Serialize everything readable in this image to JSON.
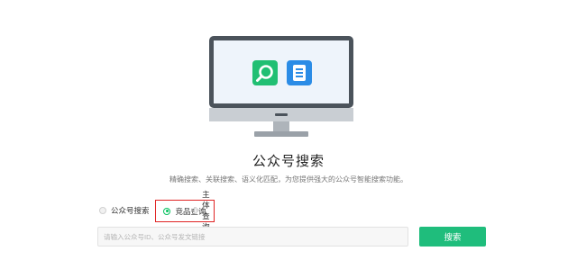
{
  "page": {
    "title": "公众号搜索",
    "subtitle": "精确搜索、关联搜索、语义化匹配，为您提供强大的公众号智能搜索功能。"
  },
  "search_modes": {
    "options": [
      {
        "label": "公众号搜索",
        "checked": false
      },
      {
        "label": "竞品查询",
        "checked": true
      },
      {
        "label": "主体查询",
        "checked": false
      }
    ]
  },
  "search": {
    "placeholder": "请输入公众号ID、公众号发文链接",
    "value": "",
    "button_label": "搜索"
  },
  "illustration": {
    "monitor_icons": [
      "search-icon",
      "document-icon"
    ]
  },
  "colors": {
    "accent_green": "#1fbd7c",
    "highlight_red": "#e02424",
    "screen_bg": "#eef4fb",
    "monitor_frame": "#4c545c",
    "doc_blue": "#2b8ce6"
  }
}
